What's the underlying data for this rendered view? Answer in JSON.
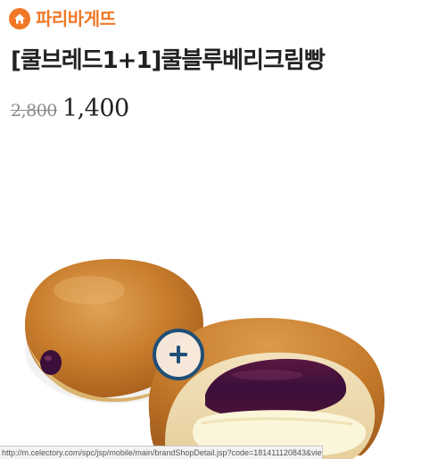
{
  "header": {
    "brand_name": "파리바게뜨",
    "brand_icon": "home-icon",
    "brand_color": "#f07826"
  },
  "product": {
    "title": "[쿨브레드1+1]쿨블루베리크림빵",
    "original_price": "2,800",
    "sale_price": "1,400",
    "image_icon": "zoom-plus-icon",
    "zoom_color": "#1f4f78"
  },
  "status_bar": {
    "url": "http://m.celectory.com/spc/jsp/mobile/main/brandShopDetail.jsp?code=181411120843&viewFor..."
  }
}
